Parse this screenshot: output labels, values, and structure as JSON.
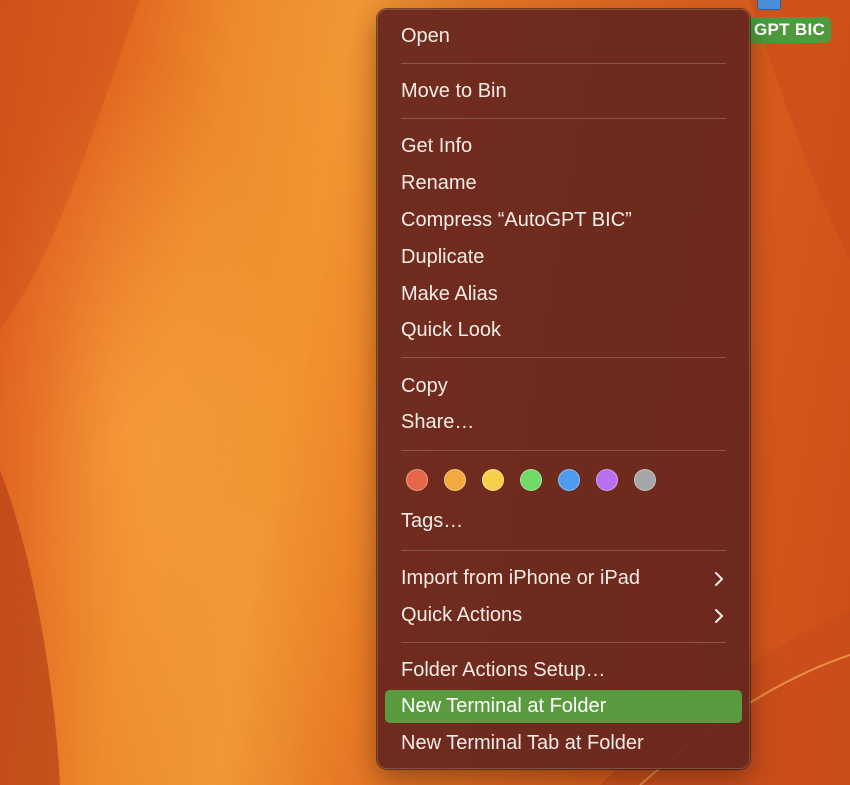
{
  "desktop": {
    "icon_label": "GPT BIC"
  },
  "menu": {
    "items": [
      {
        "label": "Open"
      },
      {
        "label": "Move to Bin"
      },
      {
        "label": "Get Info"
      },
      {
        "label": "Rename"
      },
      {
        "label": "Compress “AutoGPT BIC”"
      },
      {
        "label": "Duplicate"
      },
      {
        "label": "Make Alias"
      },
      {
        "label": "Quick Look"
      },
      {
        "label": "Copy"
      },
      {
        "label": "Share…"
      },
      {
        "label": "Tags…"
      },
      {
        "label": "Import from iPhone or iPad"
      },
      {
        "label": "Quick Actions"
      },
      {
        "label": "Folder Actions Setup…"
      },
      {
        "label": "New Terminal at Folder"
      },
      {
        "label": "New Terminal Tab at Folder"
      }
    ],
    "highlighted_item": "New Terminal at Folder",
    "highlight_color": "#5b9b3f",
    "tag_colors": [
      "#e5674a",
      "#f2a93f",
      "#f6d04b",
      "#6fdc69",
      "#4e9cf0",
      "#b76ff0",
      "#a6a6a8"
    ]
  }
}
